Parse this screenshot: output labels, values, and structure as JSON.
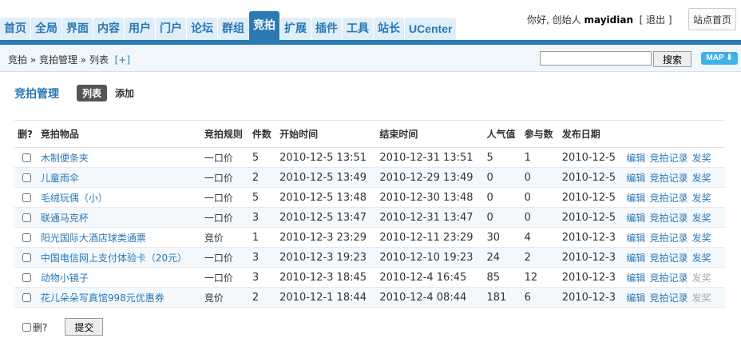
{
  "nav": {
    "items": [
      "首页",
      "全局",
      "界面",
      "内容",
      "用户",
      "门户",
      "论坛",
      "群组",
      "竞拍",
      "扩展",
      "插件",
      "工具",
      "站长",
      "UCenter"
    ],
    "active_index": 8
  },
  "user": {
    "greeting": "你好, 创始人",
    "username": "mayidian",
    "logout": "[ 退出 ]",
    "home": "站点首页"
  },
  "breadcrumb": {
    "text": "竞拍 » 竞拍管理 » 列表",
    "add": "[+]"
  },
  "search": {
    "value": "",
    "button": "搜索"
  },
  "map": {
    "label": "MAP ⬇"
  },
  "page": {
    "title": "竞拍管理",
    "tab_list": "列表",
    "tab_add": "添加"
  },
  "table": {
    "headers": [
      "删?",
      "竞拍物品",
      "竞拍规则",
      "件数",
      "开始时间",
      "结束时间",
      "人气值",
      "参与数",
      "发布日期"
    ],
    "op_labels": [
      "编辑",
      "竞拍记录",
      "发奖"
    ],
    "rows": [
      {
        "name": "木制便条夹",
        "rule": "一口价",
        "qty": "5",
        "start": "2010-12-5 13:51",
        "end": "2010-12-31 13:51",
        "pop": "5",
        "joined": "1",
        "date": "2010-12-5",
        "award_enabled": true
      },
      {
        "name": "儿童雨伞",
        "rule": "一口价",
        "qty": "2",
        "start": "2010-12-5 13:49",
        "end": "2010-12-29 13:49",
        "pop": "0",
        "joined": "0",
        "date": "2010-12-5",
        "award_enabled": true
      },
      {
        "name": "毛绒玩偶（小）",
        "rule": "一口价",
        "qty": "5",
        "start": "2010-12-5 13:48",
        "end": "2010-12-30 13:48",
        "pop": "0",
        "joined": "0",
        "date": "2010-12-5",
        "award_enabled": true
      },
      {
        "name": "联通马克杯",
        "rule": "一口价",
        "qty": "3",
        "start": "2010-12-5 13:47",
        "end": "2010-12-31 13:47",
        "pop": "0",
        "joined": "0",
        "date": "2010-12-5",
        "award_enabled": true
      },
      {
        "name": "阳光国际大酒店球类通票",
        "rule": "竞价",
        "qty": "1",
        "start": "2010-12-3 23:29",
        "end": "2010-12-11 23:29",
        "pop": "30",
        "joined": "4",
        "date": "2010-12-3",
        "award_enabled": true
      },
      {
        "name": "中国电信网上支付体验卡（20元）",
        "rule": "一口价",
        "qty": "3",
        "start": "2010-12-3 19:23",
        "end": "2010-12-10 19:23",
        "pop": "24",
        "joined": "2",
        "date": "2010-12-3",
        "award_enabled": true
      },
      {
        "name": "动物小镜子",
        "rule": "一口价",
        "qty": "3",
        "start": "2010-12-3 18:45",
        "end": "2010-12-4 16:45",
        "pop": "85",
        "joined": "12",
        "date": "2010-12-3",
        "award_enabled": false
      },
      {
        "name": "花儿朵朵写真馆998元优惠券",
        "rule": "竞价",
        "qty": "2",
        "start": "2010-12-1 18:44",
        "end": "2010-12-4 08:44",
        "pop": "181",
        "joined": "6",
        "date": "2010-12-3",
        "award_enabled": false
      }
    ]
  },
  "footer": {
    "delete_label": "删?",
    "submit": "提交"
  }
}
